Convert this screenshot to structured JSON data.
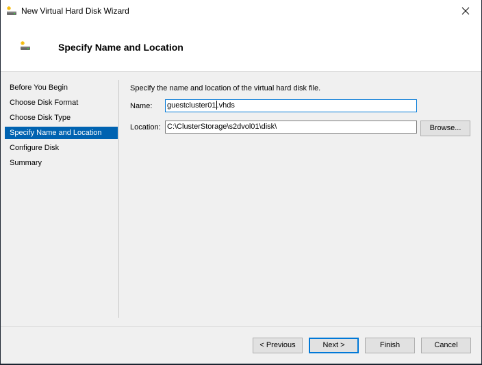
{
  "window": {
    "title": "New Virtual Hard Disk Wizard",
    "icon": "new-disk-icon",
    "close_icon": "close-icon"
  },
  "header": {
    "title": "Specify Name and Location",
    "icon": "new-disk-icon"
  },
  "sidebar": {
    "items": [
      {
        "label": "Before You Begin",
        "active": false
      },
      {
        "label": "Choose Disk Format",
        "active": false
      },
      {
        "label": "Choose Disk Type",
        "active": false
      },
      {
        "label": "Specify Name and Location",
        "active": true
      },
      {
        "label": "Configure Disk",
        "active": false
      },
      {
        "label": "Summary",
        "active": false
      }
    ]
  },
  "main": {
    "description": "Specify the name and location of the virtual hard disk file.",
    "name_label": "Name:",
    "name_value_before_caret": "guestcluster01",
    "name_value_after_caret": ".vhds",
    "location_label": "Location:",
    "location_value": "C:\\ClusterStorage\\s2dvol01\\disk\\",
    "browse_label": "Browse..."
  },
  "footer": {
    "previous_label": "< Previous",
    "next_label": "Next >",
    "finish_label": "Finish",
    "cancel_label": "Cancel"
  },
  "colors": {
    "accent": "#0078d7",
    "selection": "#0063b1"
  }
}
